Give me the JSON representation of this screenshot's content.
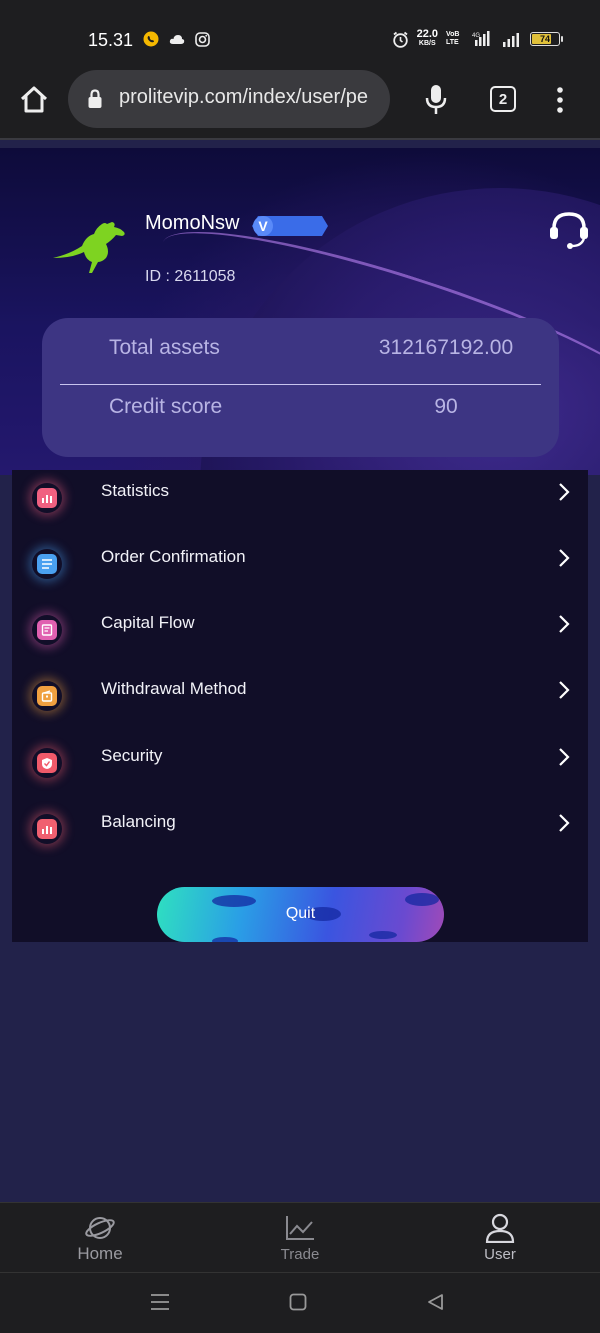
{
  "status_bar": {
    "time": "15.31",
    "net_speed": "22.0",
    "net_speed_unit": "KB/S",
    "volte": "VoB LTE",
    "signal": "4G",
    "battery": "74",
    "battery_level": 0.74
  },
  "browser": {
    "url": "prolitevip.com/index/user/pe",
    "tab_count": "2"
  },
  "profile": {
    "username": "MomoNsw",
    "vip_badge": "V",
    "user_id": "ID : 2611058"
  },
  "assets": {
    "total_label": "Total assets",
    "total_value": "312167192.00",
    "credit_label": "Credit score",
    "credit_value": "90"
  },
  "menu": {
    "items": [
      {
        "label": "Statistics",
        "icon": "chart-icon",
        "color": "#f06080"
      },
      {
        "label": "Order Confirmation",
        "icon": "checklist-icon",
        "color": "#4aa0f0"
      },
      {
        "label": "Capital Flow",
        "icon": "document-icon",
        "color": "#e060b0"
      },
      {
        "label": "Withdrawal Method",
        "icon": "wallet-icon",
        "color": "#f0a040"
      },
      {
        "label": "Security",
        "icon": "shield-icon",
        "color": "#f05a6a"
      },
      {
        "label": "Balancing",
        "icon": "chart-icon",
        "color": "#f06070"
      }
    ],
    "quit_label": "Quit"
  },
  "bottom_nav": {
    "items": [
      {
        "label": "Home",
        "icon": "planet-icon"
      },
      {
        "label": "Trade",
        "icon": "line-chart-icon"
      },
      {
        "label": "User",
        "icon": "user-icon"
      }
    ],
    "active": "User"
  },
  "colors": {
    "page_bg": "#22224a",
    "card_bg": "#3d3583",
    "menu_bg": "#110e28",
    "bar_bg": "#1e1e20"
  }
}
